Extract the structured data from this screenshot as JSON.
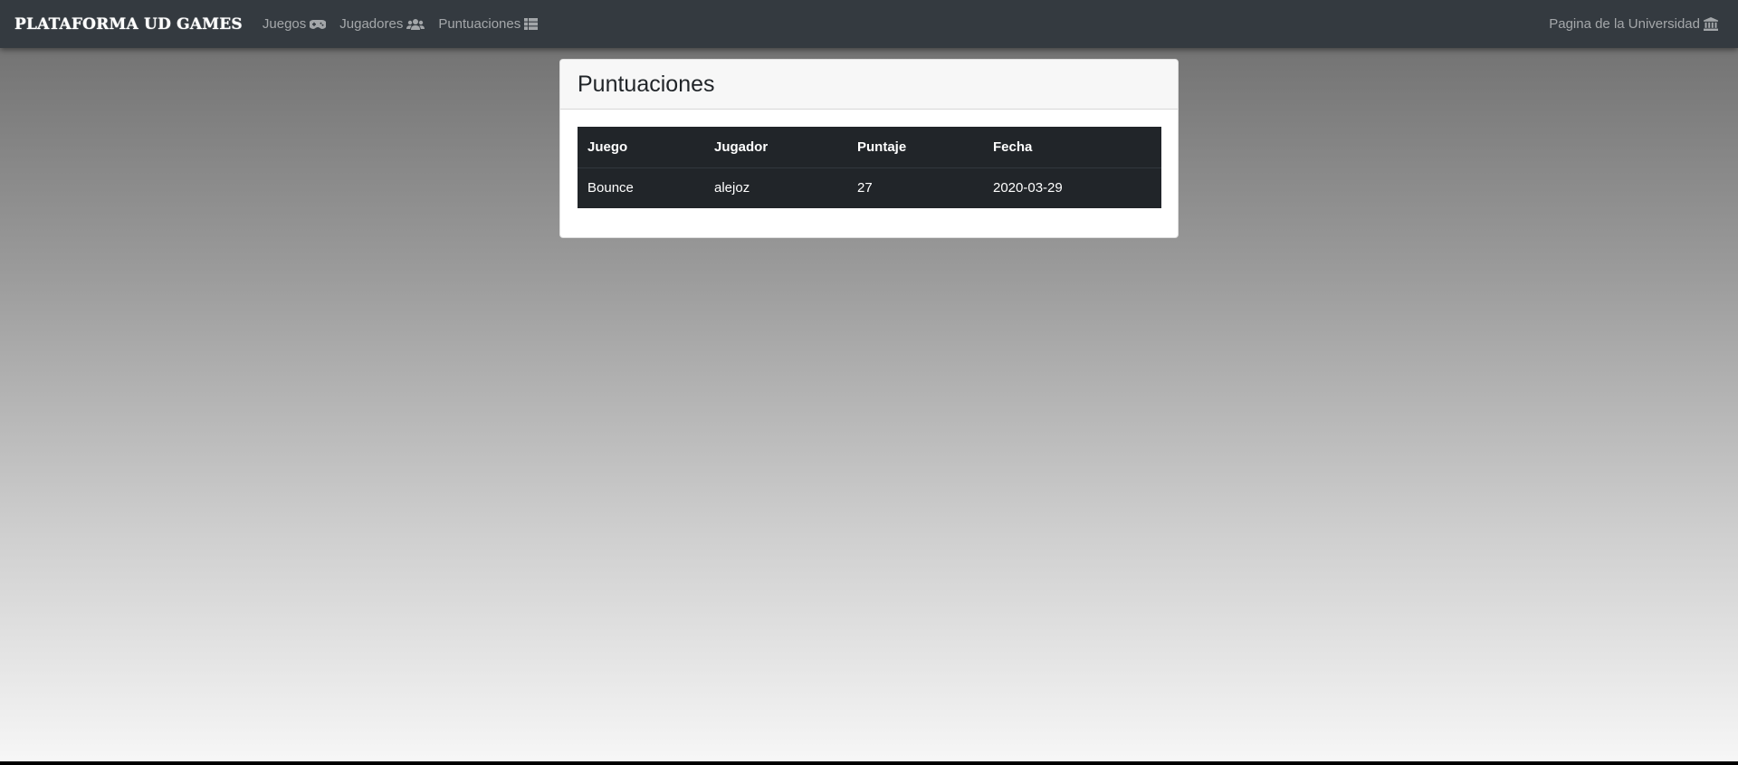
{
  "navbar": {
    "brand": "PLATAFORMA UD GAMES",
    "links": [
      {
        "label": "Juegos",
        "icon": "gamepad-icon"
      },
      {
        "label": "Jugadores",
        "icon": "users-icon"
      },
      {
        "label": "Puntuaciones",
        "icon": "list-icon"
      }
    ],
    "right_link": {
      "label": "Pagina de la Universidad",
      "icon": "university-icon"
    }
  },
  "card": {
    "title": "Puntuaciones",
    "table": {
      "headers": [
        "Juego",
        "Jugador",
        "Puntaje",
        "Fecha"
      ],
      "rows": [
        [
          "Bounce",
          "alejoz",
          "27",
          "2020-03-29"
        ]
      ]
    }
  }
}
